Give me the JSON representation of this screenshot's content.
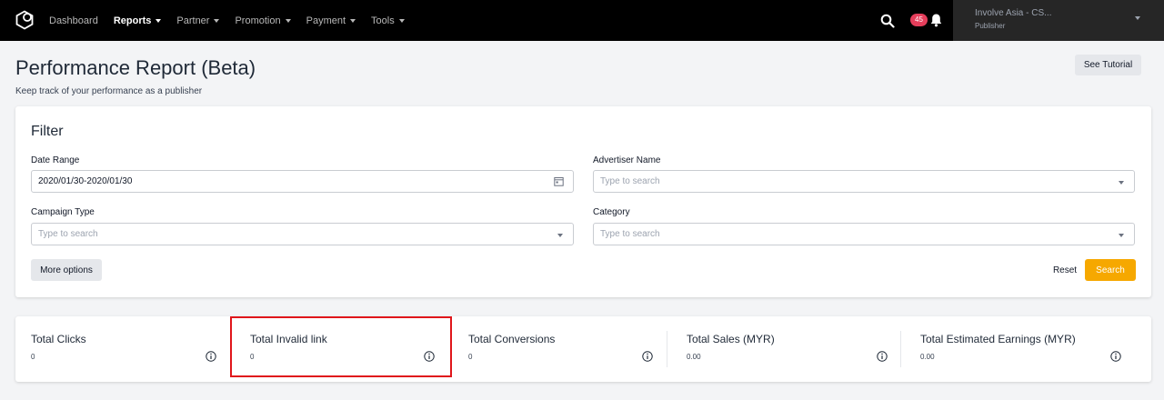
{
  "nav": {
    "items": [
      {
        "label": "Dashboard",
        "active": false,
        "dropdown": false
      },
      {
        "label": "Reports",
        "active": true,
        "dropdown": true
      },
      {
        "label": "Partner",
        "active": false,
        "dropdown": true
      },
      {
        "label": "Promotion",
        "active": false,
        "dropdown": true
      },
      {
        "label": "Payment",
        "active": false,
        "dropdown": true
      },
      {
        "label": "Tools",
        "active": false,
        "dropdown": true
      }
    ],
    "notification_count": "45",
    "account_name": "Involve Asia - CS...",
    "account_role": "Publisher",
    "icons": {
      "logo": "hexagon-logo-icon",
      "search": "search-icon",
      "bell": "bell-icon"
    }
  },
  "header": {
    "title": "Performance Report (Beta)",
    "subtitle": "Keep track of your performance as a publisher",
    "tutorial_label": "See Tutorial"
  },
  "filter": {
    "title": "Filter",
    "date_range": {
      "label": "Date Range",
      "value": "2020/01/30-2020/01/30"
    },
    "advertiser": {
      "label": "Advertiser Name",
      "placeholder": "Type to search"
    },
    "campaign_type": {
      "label": "Campaign Type",
      "placeholder": "Type to search"
    },
    "category": {
      "label": "Category",
      "placeholder": "Type to search"
    },
    "more_options_label": "More options",
    "reset_label": "Reset",
    "search_label": "Search"
  },
  "stats": [
    {
      "label": "Total Clicks",
      "value": "0"
    },
    {
      "label": "Total Invalid link",
      "value": "0"
    },
    {
      "label": "Total Conversions",
      "value": "0"
    },
    {
      "label": "Total Sales (MYR)",
      "value": "0.00"
    },
    {
      "label": "Total Estimated Earnings (MYR)",
      "value": "0.00"
    }
  ],
  "colors": {
    "accent": "#f6a800",
    "badge": "#e53e5b",
    "highlight": "#e0161b",
    "topbar": "#000000"
  }
}
